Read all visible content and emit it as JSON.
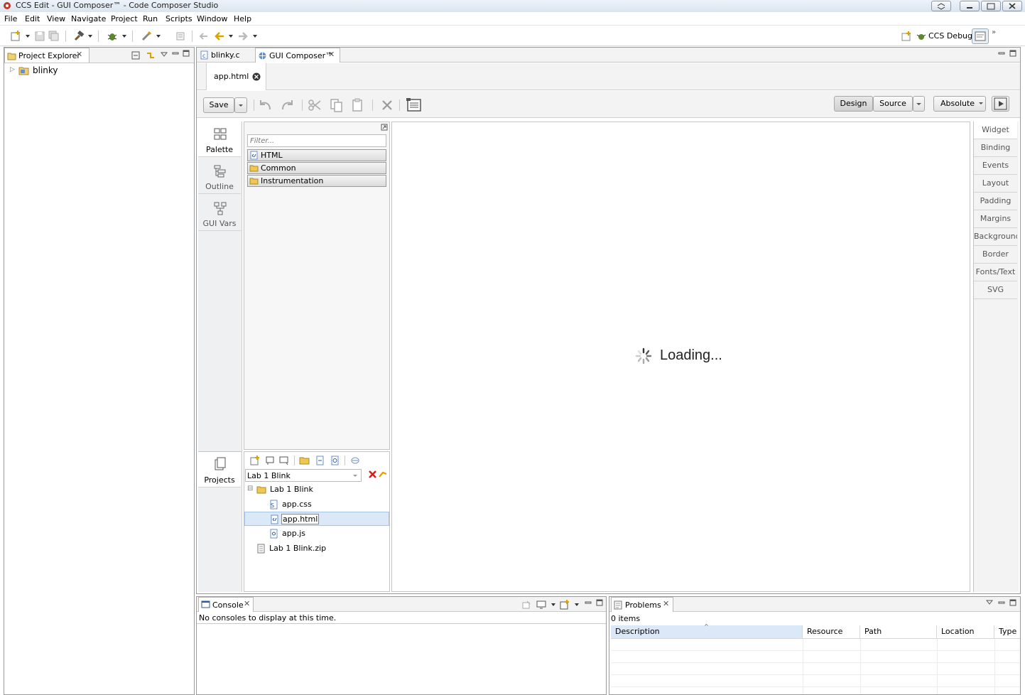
{
  "window": {
    "title": "CCS Edit - GUI Composer™ - Code Composer Studio"
  },
  "menu": [
    "File",
    "Edit",
    "View",
    "Navigate",
    "Project",
    "Run",
    "Scripts",
    "Window",
    "Help"
  ],
  "perspective": {
    "label": "CCS Debug"
  },
  "project_explorer": {
    "tab_label": "Project Explorer",
    "items": [
      {
        "label": "blinky"
      }
    ]
  },
  "editor_tabs": [
    {
      "label": "blinky.c",
      "active": false
    },
    {
      "label": "GUI Composer™",
      "active": true
    }
  ],
  "file_tab": {
    "label": "app.html"
  },
  "composer_toolbar": {
    "save_label": "Save",
    "mode_design": "Design",
    "mode_source": "Source",
    "position_label": "Absolute"
  },
  "left_tabs": [
    {
      "label": "Palette",
      "icon": "palette-grid-icon",
      "active": true
    },
    {
      "label": "Outline",
      "icon": "outline-tree-icon",
      "active": false
    },
    {
      "label": "GUI Vars",
      "icon": "gui-vars-icon",
      "active": false
    }
  ],
  "palette": {
    "filter_placeholder": "Filter...",
    "groups": [
      "HTML",
      "Common",
      "Instrumentation"
    ]
  },
  "canvas": {
    "loading_text": "Loading..."
  },
  "right_tabs": [
    "Widget",
    "Binding",
    "Events",
    "Layout",
    "Padding",
    "Margins",
    "Background",
    "Border",
    "Fonts/Text",
    "SVG"
  ],
  "projects": {
    "tab_label": "Projects",
    "selected_project": "Lab 1 Blink",
    "tree": {
      "root": "Lab 1 Blink",
      "files": [
        "app.css",
        "app.html",
        "app.js"
      ],
      "zip": "Lab 1 Blink.zip",
      "selected_file": "app.html"
    }
  },
  "console": {
    "tab_label": "Console",
    "message": "No consoles to display at this time."
  },
  "problems": {
    "tab_label": "Problems",
    "count_text": "0 items",
    "columns": [
      "Description",
      "Resource",
      "Path",
      "Location",
      "Type"
    ]
  }
}
